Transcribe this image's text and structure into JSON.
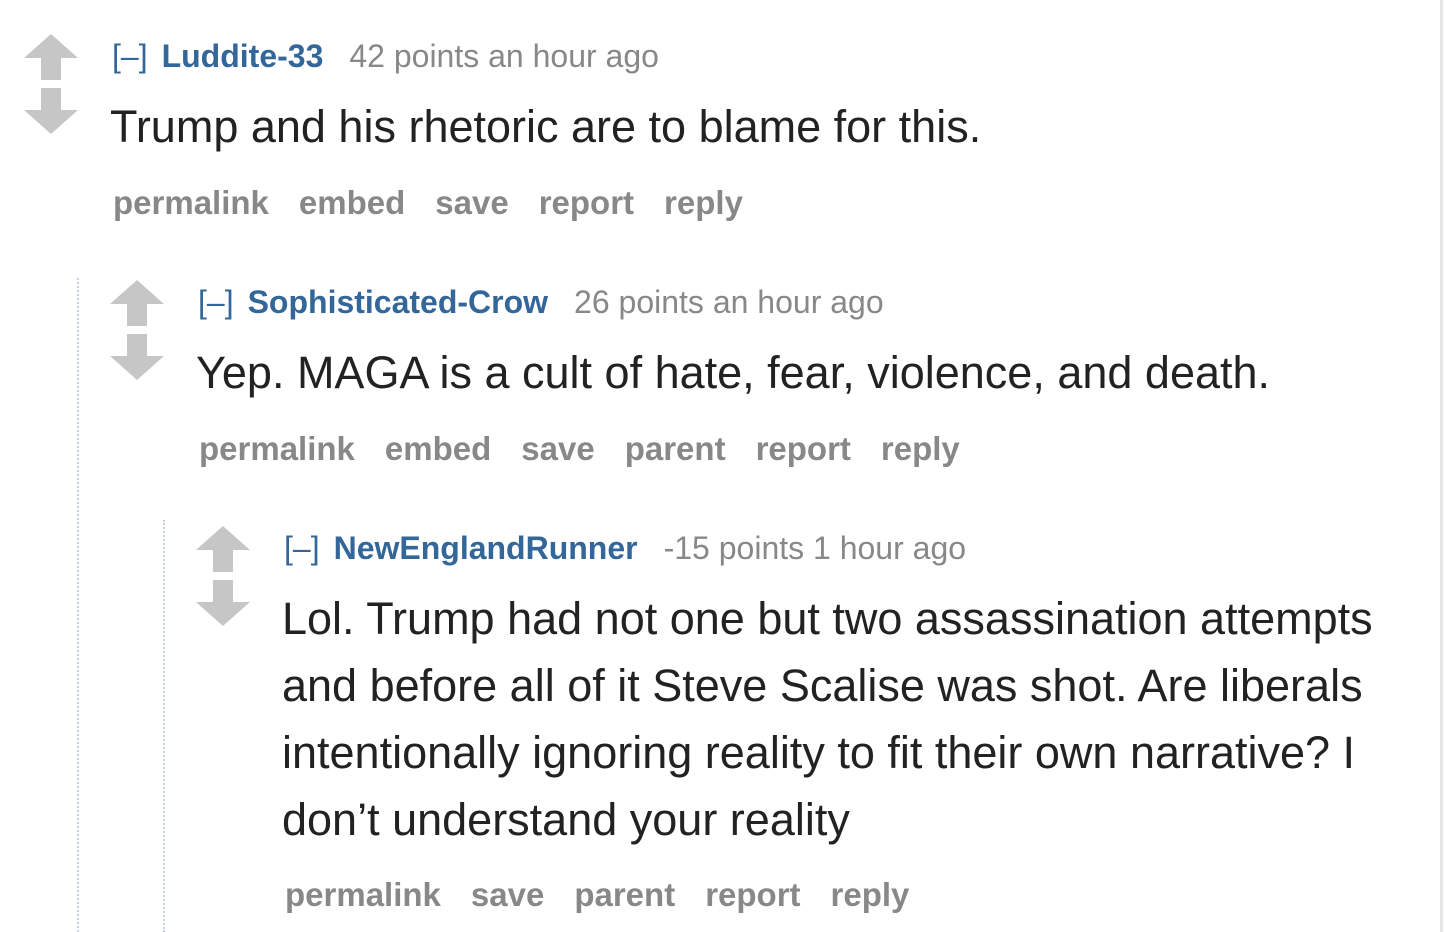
{
  "comments": [
    {
      "toggle": "[–]",
      "author": "Luddite-33",
      "score": "42 points",
      "time": "an hour ago",
      "body": [
        "Trump and his rhetoric are to blame for this."
      ],
      "actions": [
        "permalink",
        "embed",
        "save",
        "report",
        "reply"
      ]
    },
    {
      "toggle": "[–]",
      "author": "Sophisticated-Crow",
      "score": "26 points",
      "time": "an hour ago",
      "body": [
        "Yep. MAGA is a cult of hate, fear, violence, and death."
      ],
      "actions": [
        "permalink",
        "embed",
        "save",
        "parent",
        "report",
        "reply"
      ]
    },
    {
      "toggle": "[–]",
      "author": "NewEnglandRunner",
      "score": "-15 points",
      "time": "1 hour ago",
      "body": [
        "Lol. Trump had not one but two assassination attempts",
        "and before all of it Steve Scalise was shot. Are liberals",
        "intentionally ignoring reality to fit their own narrative? I",
        "don’t understand your reality"
      ],
      "actions": [
        "permalink",
        "save",
        "parent",
        "report",
        "reply"
      ]
    }
  ],
  "colors": {
    "author": "#336699",
    "meta": "#888888",
    "body": "#222222",
    "arrow": "#c6c6c6",
    "thread_line": "#c7cfe6"
  },
  "icons": {
    "upvote": "upvote-arrow-icon",
    "downvote": "downvote-arrow-icon"
  }
}
